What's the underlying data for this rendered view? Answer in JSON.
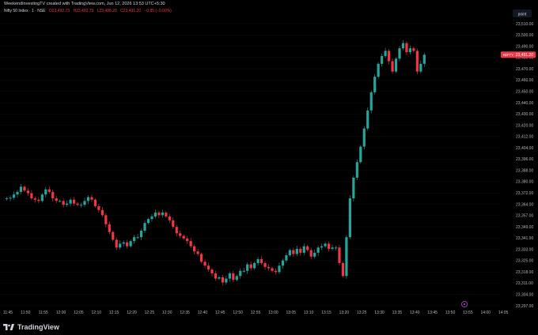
{
  "header": {
    "credit": "WeekendInvestingTV created with TradingView.com, Jun 12, 2026 13:53 UTC+5:30"
  },
  "legend": {
    "symbol": "Nifty 50 Index · 1 · NSE",
    "open": "O23,492.73",
    "high": "H23,492.73",
    "low": "L23,488.20",
    "close": "C23,491.20",
    "change": "−0.85 (−0.00%)"
  },
  "scale_button": "point",
  "price_tag": "23,491.20",
  "price_tag_label": "NIFTY",
  "footer": {
    "brand": "TradingView"
  },
  "colors": {
    "up": "#26a69a",
    "down": "#f23645",
    "background": "#000000",
    "text": "#b2b5be"
  },
  "chart_data": {
    "type": "candlestick",
    "y_ticks": [
      "23,510.00",
      "23,500.00",
      "23,490.00",
      "23,480.00",
      "23,470.00",
      "23,460.00",
      "23,450.00",
      "23,440.00",
      "23,430.00",
      "23,420.00",
      "23,412.00",
      "23,404.00",
      "23,396.00",
      "23,388.00",
      "23,380.00",
      "23,372.00",
      "23,364.00",
      "23,357.00",
      "23,349.00",
      "23,341.00",
      "23,333.00",
      "23,325.00",
      "23,318.00",
      "23,311.00",
      "23,304.00",
      "23,297.00"
    ],
    "x_ticks": [
      "11:45",
      "11:50",
      "11:55",
      "12:00",
      "12:05",
      "12:10",
      "12:15",
      "12:20",
      "12:25",
      "12:30",
      "12:35",
      "12:40",
      "12:45",
      "12:50",
      "12:55",
      "13:00",
      "13:05",
      "13:10",
      "13:15",
      "13:20",
      "13:25",
      "13:30",
      "13:35",
      "13:40",
      "13:45",
      "13:50",
      "13:55",
      "14:00",
      "14:05"
    ],
    "closes": [
      23380,
      23380.5,
      23383,
      23385,
      23389,
      23386,
      23384,
      23380,
      23379,
      23378,
      23383,
      23387,
      23385,
      23380,
      23378,
      23378,
      23375,
      23376,
      23379,
      23376,
      23375,
      23375,
      23378,
      23381,
      23379,
      23374,
      23371,
      23367,
      23360,
      23354,
      23348,
      23342,
      23345,
      23346,
      23343,
      23347,
      23350,
      23350,
      23355,
      23361,
      23364,
      23366,
      23369,
      23367,
      23369,
      23366,
      23363,
      23358,
      23353,
      23351,
      23349,
      23347,
      23343,
      23339,
      23337,
      23331,
      23328,
      23325,
      23322,
      23318,
      23319,
      23315,
      23318,
      23322,
      23317,
      23320,
      23324,
      23324,
      23329,
      23326,
      23330,
      23333,
      23330,
      23327,
      23326,
      23324,
      23323,
      23328,
      23332,
      23336,
      23340,
      23337,
      23341,
      23338,
      23343,
      23340,
      23335,
      23338,
      23342,
      23343,
      23345,
      23341,
      23342,
      23342,
      23330,
      23320,
      23350,
      23380,
      23396,
      23408,
      23420,
      23434,
      23448,
      23462,
      23474,
      23484,
      23490,
      23494,
      23486,
      23478,
      23488,
      23496,
      23500,
      23493,
      23496,
      23494,
      23478,
      23484,
      23491
    ],
    "price_range": [
      23297,
      23515
    ]
  }
}
